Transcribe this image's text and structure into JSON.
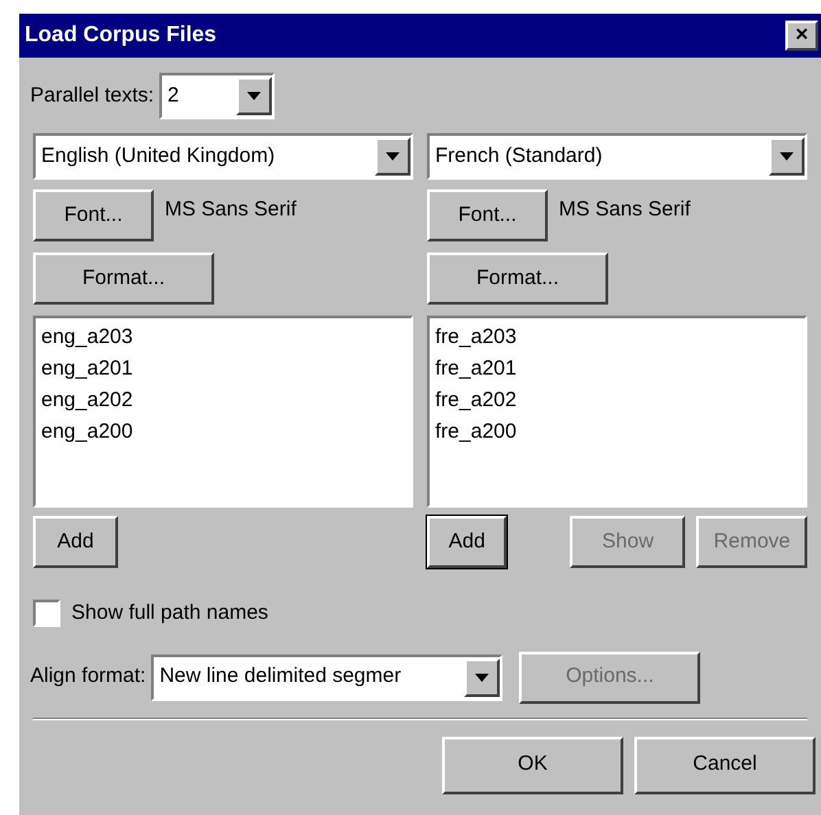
{
  "window": {
    "title": "Load Corpus Files",
    "close": "×"
  },
  "parallel_texts": {
    "label": "Parallel texts:",
    "value": "2"
  },
  "panes": [
    {
      "language": "English (United Kingdom)",
      "font_button": "Font...",
      "font_name": "MS Sans Serif",
      "format_button": "Format...",
      "files": [
        "eng_a203",
        "eng_a201",
        "eng_a202",
        "eng_a200"
      ],
      "buttons": [
        {
          "label": "Add",
          "disabled": false,
          "focused": false
        }
      ]
    },
    {
      "language": "French (Standard)",
      "font_button": "Font...",
      "font_name": "MS Sans Serif",
      "format_button": "Format...",
      "files": [
        "fre_a203",
        "fre_a201",
        "fre_a202",
        "fre_a200"
      ],
      "buttons": [
        {
          "label": "Add",
          "disabled": false,
          "focused": true
        },
        {
          "label": "Show",
          "disabled": true,
          "focused": false
        },
        {
          "label": "Remove",
          "disabled": true,
          "focused": false
        }
      ]
    }
  ],
  "show_full_path": {
    "label": "Show full path names",
    "checked": false
  },
  "align_format": {
    "label": "Align format:",
    "value": "New line delimited segmer",
    "options_button": {
      "label": "Options...",
      "disabled": true
    }
  },
  "footer_buttons": [
    {
      "label": "OK"
    },
    {
      "label": "Cancel"
    }
  ]
}
